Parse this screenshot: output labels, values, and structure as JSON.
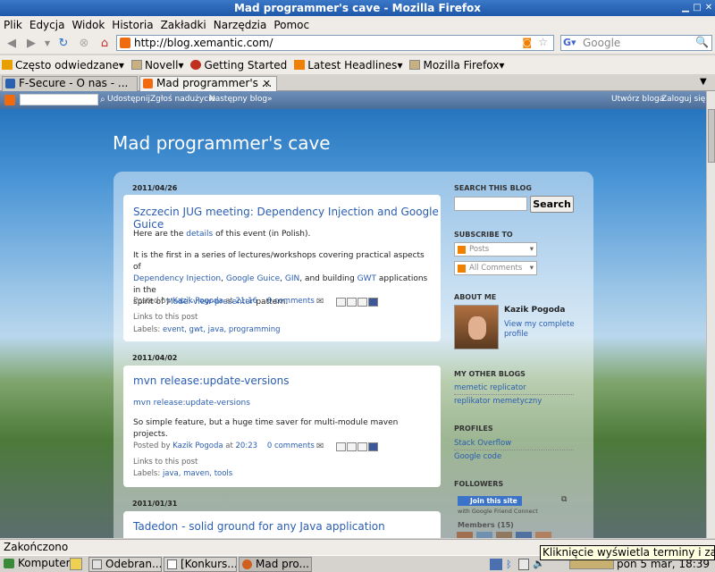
{
  "window": {
    "title": "Mad programmer's cave - Mozilla Firefox"
  },
  "menu": [
    "Plik",
    "Edycja",
    "Widok",
    "Historia",
    "Zakładki",
    "Narzędzia",
    "Pomoc"
  ],
  "nav": {
    "url": "http://blog.xemantic.com/",
    "search_placeholder": "Google"
  },
  "bookmarks": [
    "Często odwiedzane",
    "Novell",
    "Getting Started",
    "Latest Headlines",
    "Mozilla Firefox"
  ],
  "tabs": [
    {
      "label": "F-Secure - O nas - ..."
    },
    {
      "label": "Mad programmer's ..."
    }
  ],
  "blogger_bar": {
    "share": "Udostępnij",
    "report": "Zgłoś nadużycie",
    "next": "Następny blog»",
    "create": "Utwórz bloga",
    "login": "Zaloguj się"
  },
  "blog": {
    "title": "Mad programmer's cave",
    "posts": [
      {
        "date": "2011/04/26",
        "title": "Szczecin JUG meeting: Dependency Injection and Google Guice",
        "p1_a": "Here are the ",
        "p1_link": "details",
        "p1_b": " of this event (in Polish).",
        "p2_a": "It is the first in a series of lectures/workshops covering practical aspects of",
        "p2_l1": "Dependency Injection",
        "p2_sep1": ", ",
        "p2_l2": "Google Guice",
        "p2_sep2": ", ",
        "p2_l3": "GIN",
        "p2_mid": ", and building ",
        "p2_l4": "GWT",
        "p2_c": " applications in the",
        "p2_d": "spirit of ",
        "p2_l5": "Model-view-presenter",
        "p2_e": " pattern.",
        "posted_by": "Posted by",
        "author": "Kazik Pogoda",
        "at": "at",
        "time": "21:16",
        "comments": "0 comments",
        "links": "Links to this post",
        "labels_prefix": "Labels:",
        "labels": "event, gwt, java, programming"
      },
      {
        "date": "2011/04/02",
        "title": "mvn release:update-versions",
        "p1_link": "mvn release:update-versions",
        "p2": "So simple feature, but a huge time saver for multi-module maven projects.",
        "posted_by": "Posted by",
        "author": "Kazik Pogoda",
        "at": "at",
        "time": "20:23",
        "comments": "0 comments",
        "links": "Links to this post",
        "labels_prefix": "Labels:",
        "labels": "java, maven, tools"
      },
      {
        "date": "2011/01/31",
        "title": "Tadedon - solid ground for any Java application"
      }
    ],
    "sidebar": {
      "search_head": "SEARCH THIS BLOG",
      "search_button": "Search",
      "subscribe_head": "SUBSCRIBE TO",
      "posts_dd": "Posts",
      "comments_dd": "All Comments",
      "about_head": "ABOUT ME",
      "about_name": "Kazik Pogoda",
      "about_link": "View my complete profile",
      "other_head": "MY OTHER BLOGS",
      "other1": "memetic replicator",
      "other2": "replikator memetyczny",
      "profiles_head": "PROFILES",
      "profile1": "Stack Overflow",
      "profile2": "Google code",
      "followers_head": "FOLLOWERS",
      "join": "Join this site",
      "gfc": "with Google Friend Connect",
      "members": "Members (15)"
    }
  },
  "status": "Zakończono",
  "taskbar": {
    "start": "Komputer",
    "items": [
      "Odebran...",
      "[Konkurs...",
      "Mad pro..."
    ],
    "clock": "pon  5 mar, 18:39",
    "tooltip": "Kliknięcie wyświetla terminy i zadania"
  },
  "colors": {
    "link": "#2a5db0",
    "title_bar": "#1f58a8",
    "blogger_orange": "#f06a0f"
  }
}
